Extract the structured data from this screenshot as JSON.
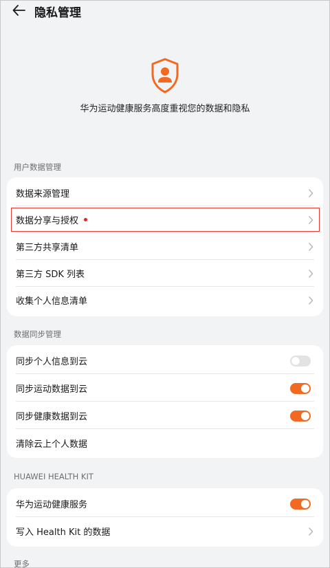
{
  "header": {
    "title": "隐私管理"
  },
  "hero": {
    "text": "华为运动健康服务高度重视您的数据和隐私"
  },
  "accent_color": "#f26a21",
  "sections": {
    "user_data": {
      "title": "用户数据管理",
      "items": [
        {
          "label": "数据来源管理"
        },
        {
          "label": "数据分享与授权"
        },
        {
          "label": "第三方共享清单"
        },
        {
          "label": "第三方 SDK 列表"
        },
        {
          "label": "收集个人信息清单"
        }
      ]
    },
    "sync": {
      "title": "数据同步管理",
      "items": [
        {
          "label": "同步个人信息到云",
          "toggle": false
        },
        {
          "label": "同步运动数据到云",
          "toggle": true
        },
        {
          "label": "同步健康数据到云",
          "toggle": true
        },
        {
          "label": "清除云上个人数据"
        }
      ]
    },
    "health_kit": {
      "title": "HUAWEI HEALTH KIT",
      "items": [
        {
          "label": "华为运动健康服务",
          "toggle": true
        },
        {
          "label": "写入 Health Kit 的数据"
        }
      ]
    },
    "more": {
      "title": "更多"
    }
  }
}
